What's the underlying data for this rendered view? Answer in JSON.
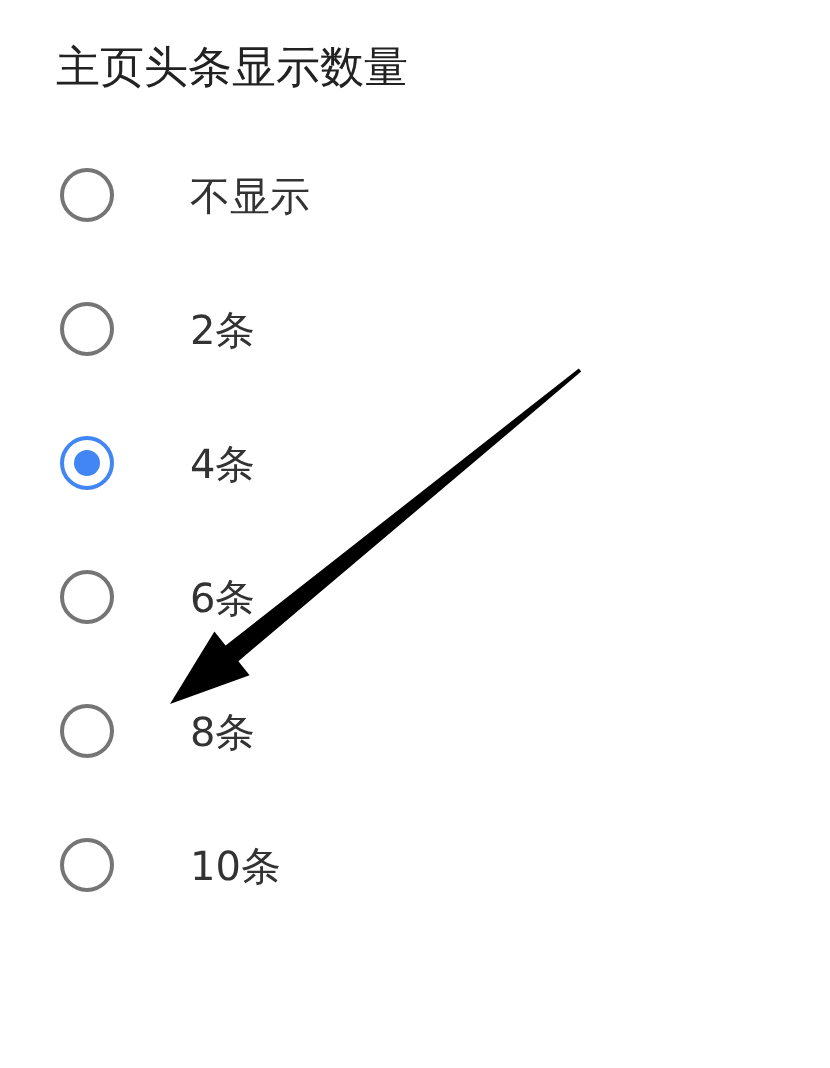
{
  "title": "主页头条显示数量",
  "options": [
    {
      "label": "不显示",
      "selected": false
    },
    {
      "label": "2条",
      "selected": false
    },
    {
      "label": "4条",
      "selected": true
    },
    {
      "label": "6条",
      "selected": false
    },
    {
      "label": "8条",
      "selected": false
    },
    {
      "label": "10条",
      "selected": false
    }
  ]
}
